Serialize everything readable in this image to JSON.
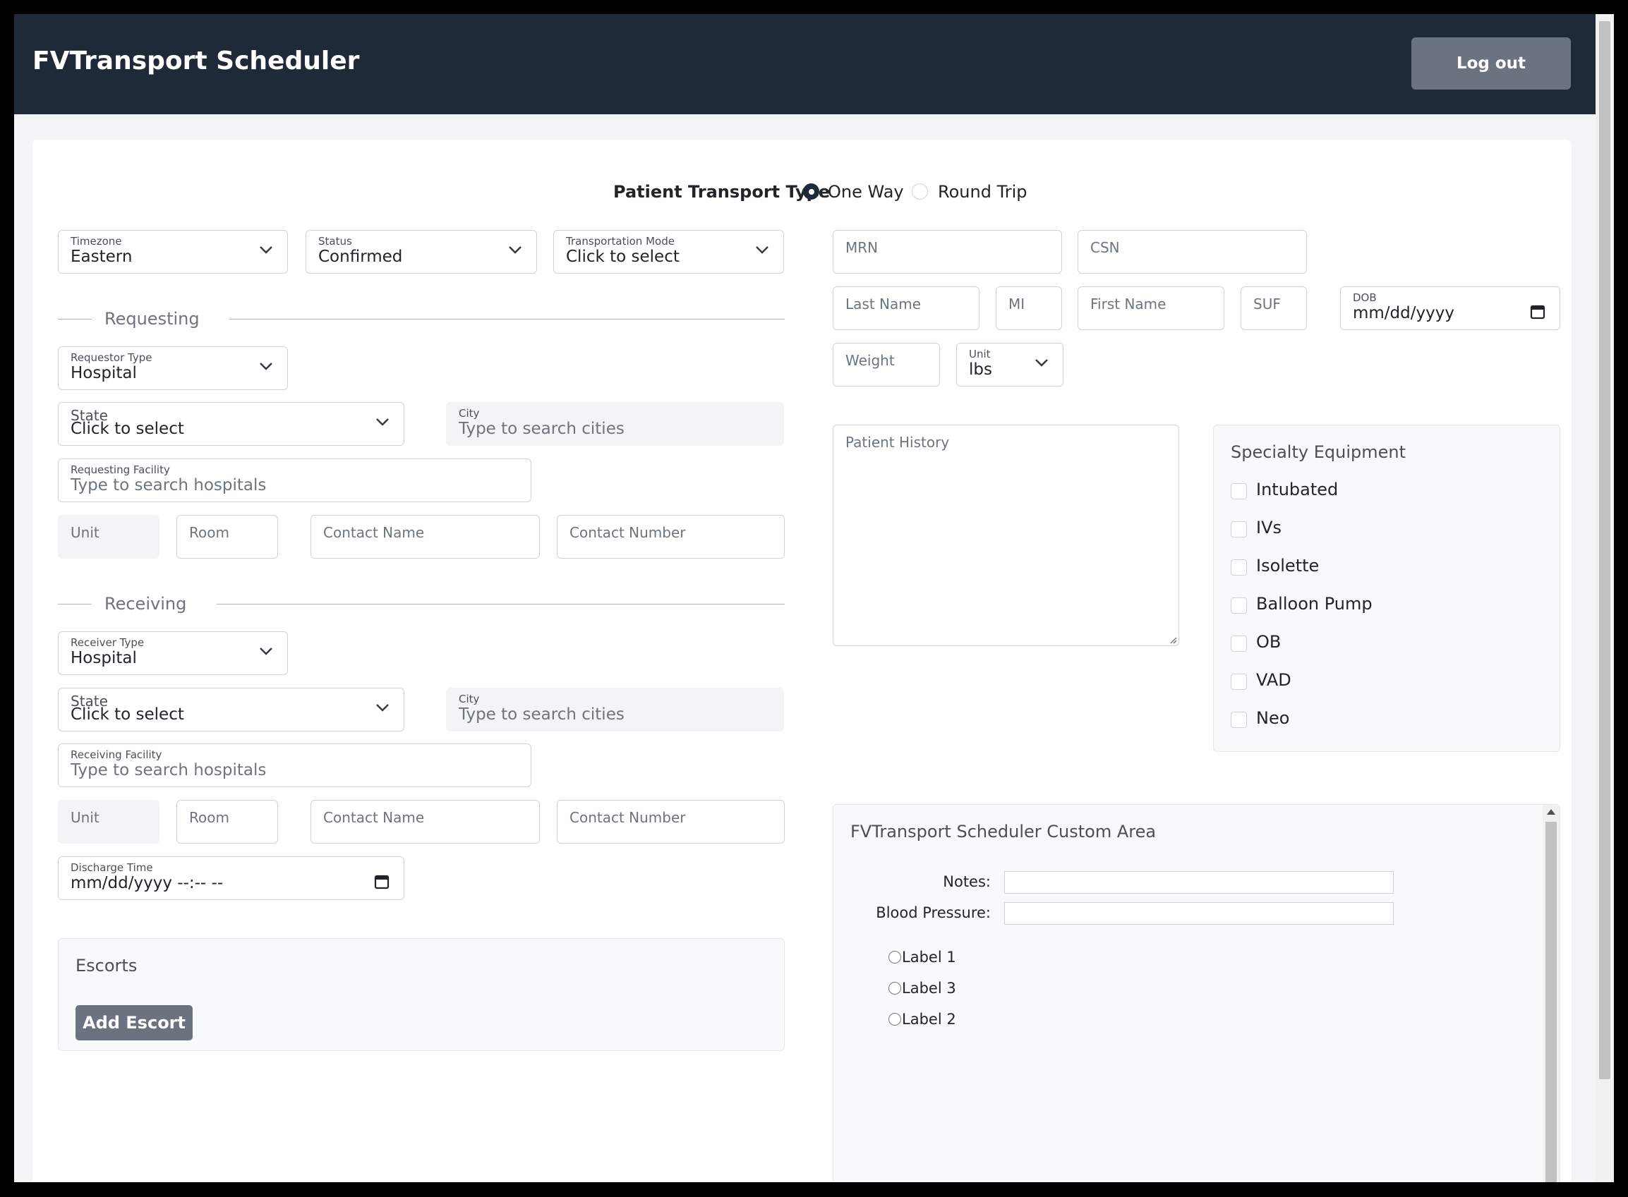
{
  "app": {
    "title": "FVTransport Scheduler",
    "logout_label": "Log out"
  },
  "transport_type": {
    "label": "Patient Transport Type",
    "options": [
      "One Way",
      "Round Trip"
    ],
    "selected": "One Way"
  },
  "top_selects": {
    "timezone": {
      "label": "Timezone",
      "value": "Eastern"
    },
    "status": {
      "label": "Status",
      "value": "Confirmed"
    },
    "transport_mode": {
      "label": "Transportation Mode",
      "value": "Click to select"
    }
  },
  "requesting": {
    "title": "Requesting",
    "requestor_type": {
      "label": "Requestor Type",
      "value": "Hospital"
    },
    "state": {
      "label": "State",
      "value": "Click to select"
    },
    "city": {
      "label": "City",
      "placeholder": "Type to search cities"
    },
    "facility": {
      "label": "Requesting Facility",
      "placeholder": "Type to search hospitals"
    },
    "unit": "Unit",
    "room": "Room",
    "contact_name": "Contact Name",
    "contact_number": "Contact Number"
  },
  "receiving": {
    "title": "Receiving",
    "receiver_type": {
      "label": "Receiver Type",
      "value": "Hospital"
    },
    "state": {
      "label": "State",
      "value": "Click to select"
    },
    "city": {
      "label": "City",
      "placeholder": "Type to search cities"
    },
    "facility": {
      "label": "Receiving Facility",
      "placeholder": "Type to search hospitals"
    },
    "unit": "Unit",
    "room": "Room",
    "contact_name": "Contact Name",
    "contact_number": "Contact Number",
    "discharge": {
      "label": "Discharge Time",
      "value": "mm/dd/yyyy --:-- --"
    }
  },
  "escorts": {
    "title": "Escorts",
    "add_label": "Add Escort"
  },
  "patient": {
    "mrn": "MRN",
    "csn": "CSN",
    "last_name": "Last Name",
    "mi": "MI",
    "first_name": "First Name",
    "suf": "SUF",
    "dob": {
      "label": "DOB",
      "value": "mm/dd/yyyy"
    },
    "weight": "Weight",
    "unit": {
      "label": "Unit",
      "value": "lbs"
    },
    "history": "Patient History"
  },
  "equipment": {
    "title": "Specialty Equipment",
    "items": [
      "Intubated",
      "IVs",
      "Isolette",
      "Balloon Pump",
      "OB",
      "VAD",
      "Neo"
    ]
  },
  "custom_area": {
    "title": "FVTransport Scheduler Custom Area",
    "notes_label": "Notes:",
    "bp_label": "Blood Pressure:",
    "radios": [
      "Label 1",
      "Label 3",
      "Label 2"
    ]
  },
  "colors": {
    "navbar": "#1f2937",
    "button": "#6b7280",
    "background": "#f3f4f6"
  },
  "icons": [
    "chevron-down-icon",
    "calendar-icon"
  ]
}
